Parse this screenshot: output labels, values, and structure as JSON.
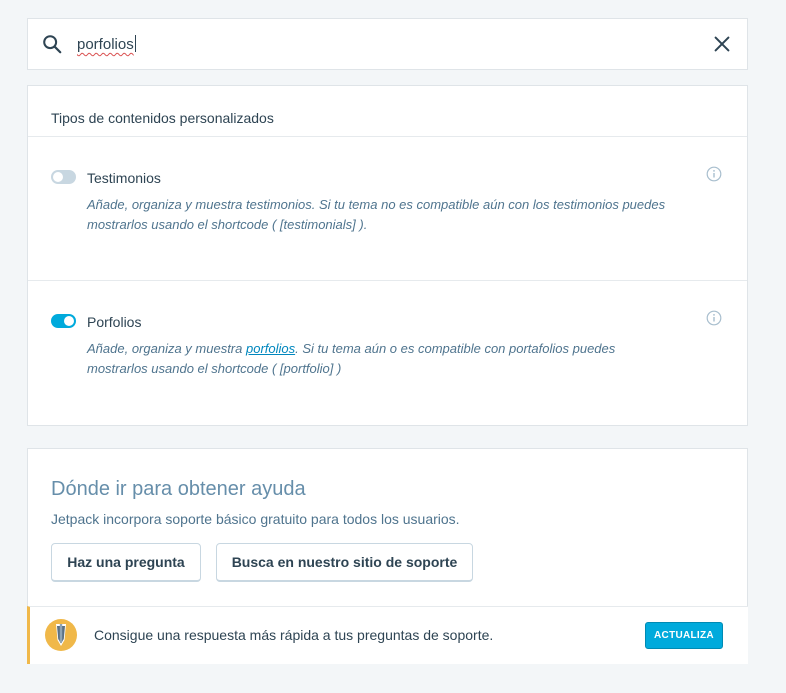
{
  "search": {
    "query": "porfolios"
  },
  "settings": {
    "section_title": "Tipos de contenidos personalizados",
    "modules": [
      {
        "title": "Testimonios",
        "enabled": false,
        "description": "Añade, organiza y muestra testimonios. Si tu tema no es compatible aún con los testimonios puedes mostrarlos usando el shortcode ( [testimonials] )."
      },
      {
        "title": "Porfolios",
        "enabled": true,
        "description_pre": "Añade, organiza y muestra ",
        "description_link": "porfolios",
        "description_post": ". Si tu tema aún o es compatible con portafolios puedes mostrarlos usando el shortcode ( [portfolio] )"
      }
    ]
  },
  "help": {
    "title": "Dónde ir para obtener ayuda",
    "subtitle": "Jetpack incorpora soporte básico gratuito para todos los usuarios.",
    "ask_button": "Haz una pregunta",
    "search_button": "Busca en nuestro sitio de soporte"
  },
  "notice": {
    "text": "Consigue una respuesta más rápida a tus preguntas de soporte.",
    "button": "ACTUALIZA"
  },
  "colors": {
    "accent": "#00aadc",
    "notice_border": "#f0b849",
    "heading_blue": "#668eaa"
  }
}
